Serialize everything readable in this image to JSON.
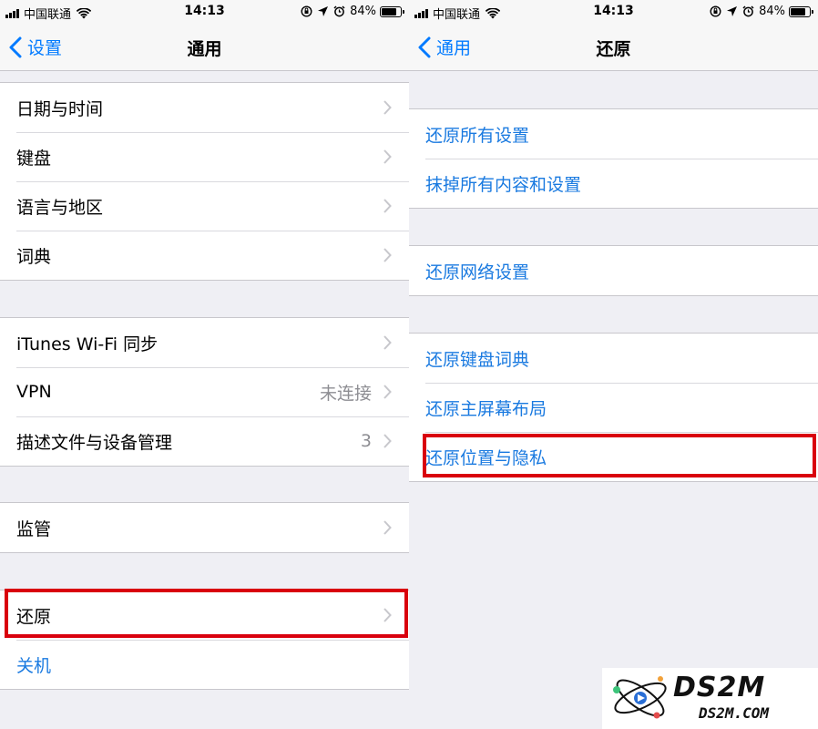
{
  "status": {
    "carrier": "中国联通",
    "time": "14:13",
    "battery": "84%",
    "battery_level": 0.84
  },
  "left": {
    "back_label": "设置",
    "title": "通用",
    "groups": [
      {
        "rows": [
          {
            "label": "日期与时间"
          },
          {
            "label": "键盘"
          },
          {
            "label": "语言与地区"
          },
          {
            "label": "词典"
          }
        ]
      },
      {
        "rows": [
          {
            "label": "iTunes Wi-Fi 同步"
          },
          {
            "label": "VPN",
            "value": "未连接"
          },
          {
            "label": "描述文件与设备管理",
            "value": "3"
          }
        ]
      },
      {
        "rows": [
          {
            "label": "监管"
          }
        ]
      },
      {
        "rows": [
          {
            "label": "还原"
          },
          {
            "label": "关机"
          }
        ]
      }
    ]
  },
  "right": {
    "back_label": "通用",
    "title": "还原",
    "groups": [
      {
        "rows": [
          {
            "label": "还原所有设置"
          },
          {
            "label": "抹掉所有内容和设置"
          }
        ]
      },
      {
        "rows": [
          {
            "label": "还原网络设置"
          }
        ]
      },
      {
        "rows": [
          {
            "label": "还原键盘词典"
          },
          {
            "label": "还原主屏幕布局"
          },
          {
            "label": "还原位置与隐私"
          }
        ]
      }
    ]
  },
  "watermark": {
    "brand": "DS2M",
    "domain": "DS2M.COM"
  },
  "colors": {
    "ios_blue": "#007aff",
    "highlight_red": "#d9000d"
  },
  "icons": {
    "back": "chevron-left-icon",
    "disclosure": "chevron-right-icon",
    "wifi": "wifi-icon",
    "signal": "signal-bars-icon",
    "battery": "battery-icon"
  }
}
